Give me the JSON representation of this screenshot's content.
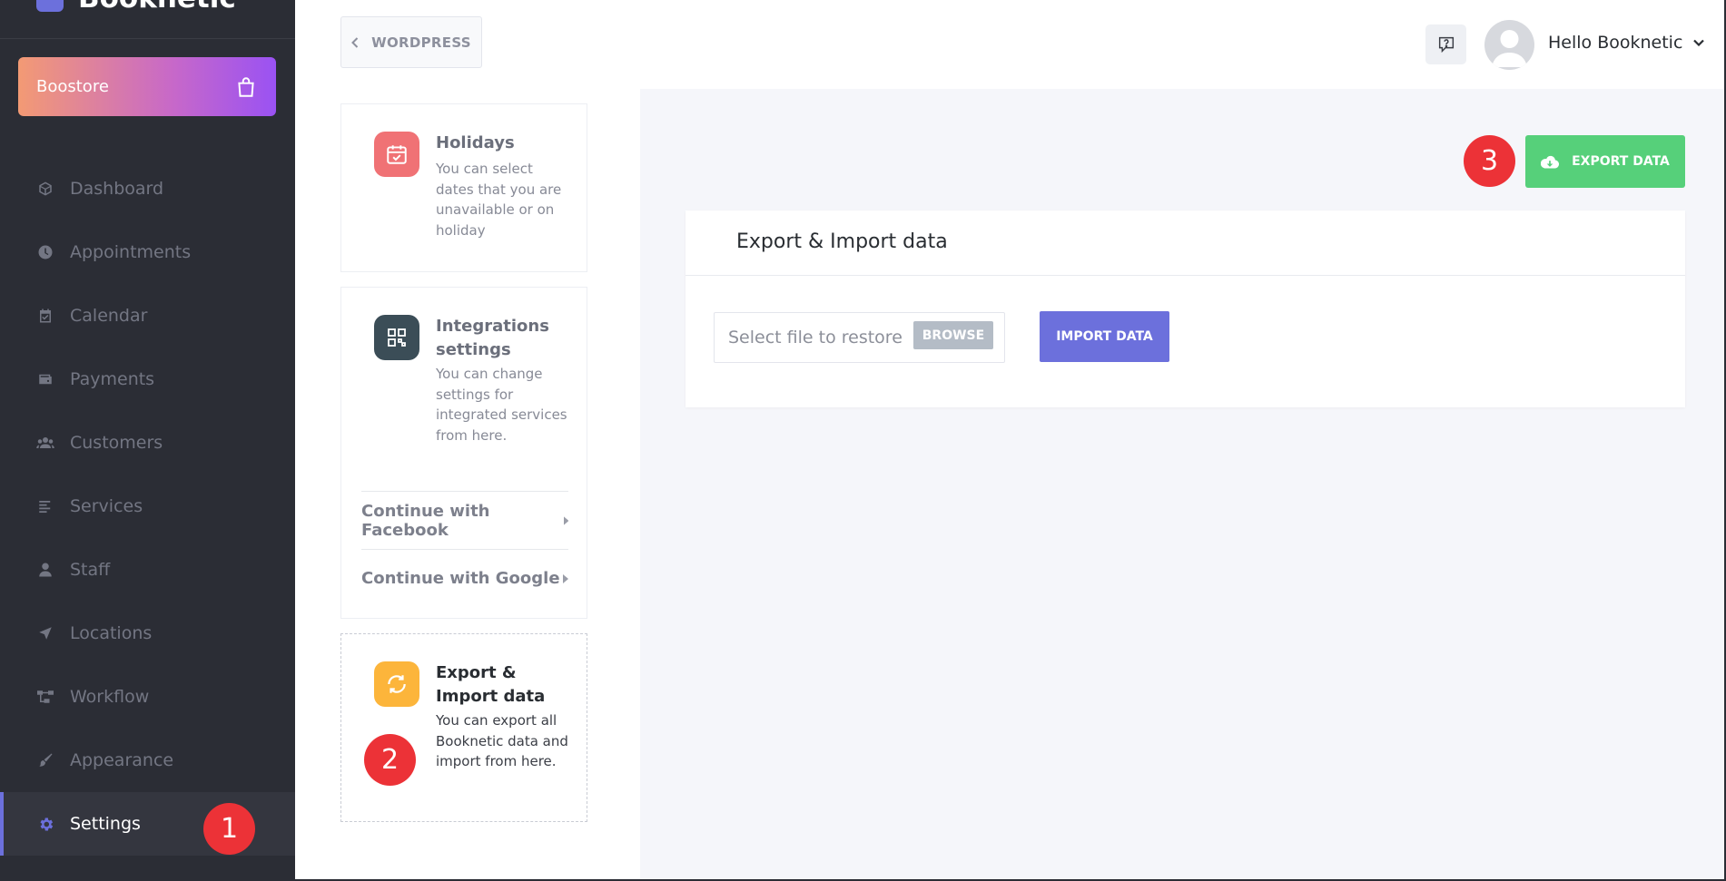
{
  "app": {
    "name": "Booknetic"
  },
  "boostore": {
    "label": "Boostore"
  },
  "nav": [
    {
      "label": "Dashboard",
      "icon": "cube-icon"
    },
    {
      "label": "Appointments",
      "icon": "clock-icon"
    },
    {
      "label": "Calendar",
      "icon": "calendar-check-icon"
    },
    {
      "label": "Payments",
      "icon": "wallet-icon"
    },
    {
      "label": "Customers",
      "icon": "users-icon"
    },
    {
      "label": "Services",
      "icon": "list-icon"
    },
    {
      "label": "Staff",
      "icon": "user-icon"
    },
    {
      "label": "Locations",
      "icon": "location-arrow-icon"
    },
    {
      "label": "Workflow",
      "icon": "workflow-icon"
    },
    {
      "label": "Appearance",
      "icon": "brush-icon"
    },
    {
      "label": "Settings",
      "icon": "gear-icon",
      "active": true
    }
  ],
  "topbar": {
    "back_label": "WORDPRESS",
    "greeting": "Hello Booknetic"
  },
  "settings": {
    "holidays": {
      "title": "Holidays",
      "desc": "You can select dates that you are unavailable or on holiday"
    },
    "integrations": {
      "title": "Integrations settings",
      "desc": "You can change settings for integrated services from here.",
      "links": [
        "Continue with Facebook",
        "Continue with Google"
      ]
    },
    "export": {
      "title": "Export & Import data",
      "desc": "You can export all Booknetic data and import from here."
    }
  },
  "main": {
    "export_label": "EXPORT DATA",
    "panel_title": "Export & Import data",
    "file_placeholder": "Select file to restore",
    "browse_label": "BROWSE",
    "import_label": "IMPORT DATA"
  },
  "badges": [
    "1",
    "2",
    "3"
  ],
  "colors": {
    "sidebar": "#2b2d35",
    "accent": "#6c70dc",
    "export_green": "#56d07a",
    "badge_red": "#ec3237"
  }
}
